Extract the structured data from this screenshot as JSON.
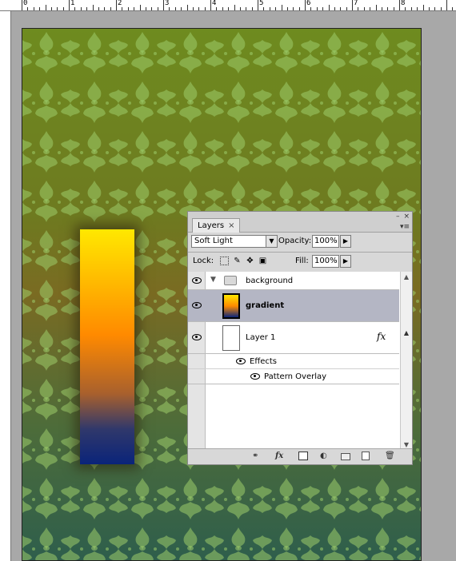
{
  "ruler": {
    "labels": [
      "0",
      "1",
      "2",
      "3",
      "4",
      "5",
      "6",
      "7",
      "8"
    ]
  },
  "layers_panel": {
    "tab_title": "Layers",
    "tab_close": "×",
    "window_min": "–",
    "window_close": "×",
    "menu": "▾≡",
    "blend_mode": "Soft Light",
    "opacity_label": "Opacity:",
    "opacity_value": "100%",
    "lock_label": "Lock:",
    "fill_label": "Fill:",
    "fill_value": "100%",
    "layers": [
      {
        "name": "background",
        "type": "group",
        "expanded": true
      },
      {
        "name": "gradient",
        "type": "layer",
        "selected": true
      },
      {
        "name": "Layer 1",
        "type": "layer",
        "fx": "fx"
      }
    ],
    "effects_label": "Effects",
    "effect_items": [
      "Pattern Overlay"
    ],
    "bottom_icons": [
      "link-icon",
      "fx-icon",
      "mask-icon",
      "adjustment-icon",
      "folder-icon",
      "new-layer-icon",
      "trash-icon"
    ],
    "fx_label": "fx"
  },
  "colors": {
    "selection": "#b4b6c4",
    "panel_bg": "#d8d8d8"
  }
}
